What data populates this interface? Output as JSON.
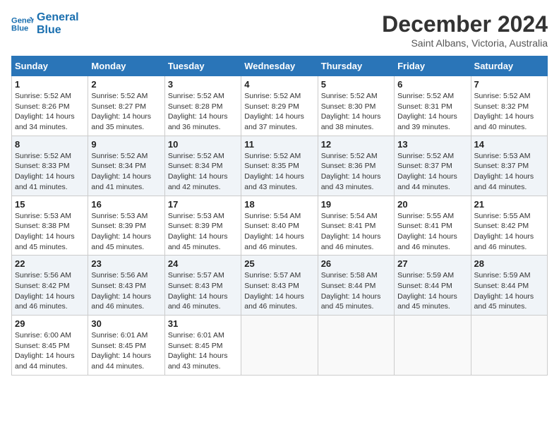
{
  "header": {
    "logo_line1": "General",
    "logo_line2": "Blue",
    "month_title": "December 2024",
    "location": "Saint Albans, Victoria, Australia"
  },
  "days_of_week": [
    "Sunday",
    "Monday",
    "Tuesday",
    "Wednesday",
    "Thursday",
    "Friday",
    "Saturday"
  ],
  "weeks": [
    [
      {
        "day": "1",
        "info": "Sunrise: 5:52 AM\nSunset: 8:26 PM\nDaylight: 14 hours\nand 34 minutes."
      },
      {
        "day": "2",
        "info": "Sunrise: 5:52 AM\nSunset: 8:27 PM\nDaylight: 14 hours\nand 35 minutes."
      },
      {
        "day": "3",
        "info": "Sunrise: 5:52 AM\nSunset: 8:28 PM\nDaylight: 14 hours\nand 36 minutes."
      },
      {
        "day": "4",
        "info": "Sunrise: 5:52 AM\nSunset: 8:29 PM\nDaylight: 14 hours\nand 37 minutes."
      },
      {
        "day": "5",
        "info": "Sunrise: 5:52 AM\nSunset: 8:30 PM\nDaylight: 14 hours\nand 38 minutes."
      },
      {
        "day": "6",
        "info": "Sunrise: 5:52 AM\nSunset: 8:31 PM\nDaylight: 14 hours\nand 39 minutes."
      },
      {
        "day": "7",
        "info": "Sunrise: 5:52 AM\nSunset: 8:32 PM\nDaylight: 14 hours\nand 40 minutes."
      }
    ],
    [
      {
        "day": "8",
        "info": "Sunrise: 5:52 AM\nSunset: 8:33 PM\nDaylight: 14 hours\nand 41 minutes."
      },
      {
        "day": "9",
        "info": "Sunrise: 5:52 AM\nSunset: 8:34 PM\nDaylight: 14 hours\nand 41 minutes."
      },
      {
        "day": "10",
        "info": "Sunrise: 5:52 AM\nSunset: 8:34 PM\nDaylight: 14 hours\nand 42 minutes."
      },
      {
        "day": "11",
        "info": "Sunrise: 5:52 AM\nSunset: 8:35 PM\nDaylight: 14 hours\nand 43 minutes."
      },
      {
        "day": "12",
        "info": "Sunrise: 5:52 AM\nSunset: 8:36 PM\nDaylight: 14 hours\nand 43 minutes."
      },
      {
        "day": "13",
        "info": "Sunrise: 5:52 AM\nSunset: 8:37 PM\nDaylight: 14 hours\nand 44 minutes."
      },
      {
        "day": "14",
        "info": "Sunrise: 5:53 AM\nSunset: 8:37 PM\nDaylight: 14 hours\nand 44 minutes."
      }
    ],
    [
      {
        "day": "15",
        "info": "Sunrise: 5:53 AM\nSunset: 8:38 PM\nDaylight: 14 hours\nand 45 minutes."
      },
      {
        "day": "16",
        "info": "Sunrise: 5:53 AM\nSunset: 8:39 PM\nDaylight: 14 hours\nand 45 minutes."
      },
      {
        "day": "17",
        "info": "Sunrise: 5:53 AM\nSunset: 8:39 PM\nDaylight: 14 hours\nand 45 minutes."
      },
      {
        "day": "18",
        "info": "Sunrise: 5:54 AM\nSunset: 8:40 PM\nDaylight: 14 hours\nand 46 minutes."
      },
      {
        "day": "19",
        "info": "Sunrise: 5:54 AM\nSunset: 8:41 PM\nDaylight: 14 hours\nand 46 minutes."
      },
      {
        "day": "20",
        "info": "Sunrise: 5:55 AM\nSunset: 8:41 PM\nDaylight: 14 hours\nand 46 minutes."
      },
      {
        "day": "21",
        "info": "Sunrise: 5:55 AM\nSunset: 8:42 PM\nDaylight: 14 hours\nand 46 minutes."
      }
    ],
    [
      {
        "day": "22",
        "info": "Sunrise: 5:56 AM\nSunset: 8:42 PM\nDaylight: 14 hours\nand 46 minutes."
      },
      {
        "day": "23",
        "info": "Sunrise: 5:56 AM\nSunset: 8:43 PM\nDaylight: 14 hours\nand 46 minutes."
      },
      {
        "day": "24",
        "info": "Sunrise: 5:57 AM\nSunset: 8:43 PM\nDaylight: 14 hours\nand 46 minutes."
      },
      {
        "day": "25",
        "info": "Sunrise: 5:57 AM\nSunset: 8:43 PM\nDaylight: 14 hours\nand 46 minutes."
      },
      {
        "day": "26",
        "info": "Sunrise: 5:58 AM\nSunset: 8:44 PM\nDaylight: 14 hours\nand 45 minutes."
      },
      {
        "day": "27",
        "info": "Sunrise: 5:59 AM\nSunset: 8:44 PM\nDaylight: 14 hours\nand 45 minutes."
      },
      {
        "day": "28",
        "info": "Sunrise: 5:59 AM\nSunset: 8:44 PM\nDaylight: 14 hours\nand 45 minutes."
      }
    ],
    [
      {
        "day": "29",
        "info": "Sunrise: 6:00 AM\nSunset: 8:45 PM\nDaylight: 14 hours\nand 44 minutes."
      },
      {
        "day": "30",
        "info": "Sunrise: 6:01 AM\nSunset: 8:45 PM\nDaylight: 14 hours\nand 44 minutes."
      },
      {
        "day": "31",
        "info": "Sunrise: 6:01 AM\nSunset: 8:45 PM\nDaylight: 14 hours\nand 43 minutes."
      },
      {
        "day": "",
        "info": ""
      },
      {
        "day": "",
        "info": ""
      },
      {
        "day": "",
        "info": ""
      },
      {
        "day": "",
        "info": ""
      }
    ]
  ]
}
